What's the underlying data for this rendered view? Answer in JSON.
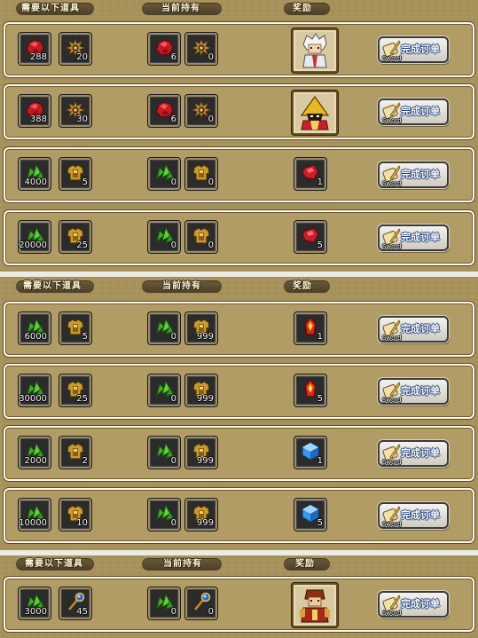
{
  "headers": {
    "required": "需要以下道具",
    "current": "当前持有",
    "reward": "奖励"
  },
  "button": {
    "label": "完成订单",
    "sub": "Sword"
  },
  "sections": [
    {
      "rows": [
        {
          "req": [
            {
              "icon": "red-ore-icon",
              "qty": "288"
            },
            {
              "icon": "bronze-emblem-icon",
              "qty": "20"
            }
          ],
          "have": [
            {
              "icon": "red-ore-icon",
              "qty": "6"
            },
            {
              "icon": "bronze-emblem-icon",
              "qty": "0"
            }
          ],
          "reward": {
            "type": "portrait",
            "icon": "white-haired-hero-portrait"
          }
        },
        {
          "req": [
            {
              "icon": "red-ore-icon",
              "qty": "388"
            },
            {
              "icon": "bronze-emblem-icon",
              "qty": "30"
            }
          ],
          "have": [
            {
              "icon": "red-ore-icon",
              "qty": "6"
            },
            {
              "icon": "bronze-emblem-icon",
              "qty": "0"
            }
          ],
          "reward": {
            "type": "portrait",
            "icon": "golden-helm-hero-portrait"
          }
        },
        {
          "req": [
            {
              "icon": "green-leaf-icon",
              "qty": "4000"
            },
            {
              "icon": "gold-armor-icon",
              "qty": "5"
            }
          ],
          "have": [
            {
              "icon": "green-leaf-icon",
              "qty": "0"
            },
            {
              "icon": "gold-armor-icon",
              "qty": "0"
            }
          ],
          "reward": {
            "type": "item",
            "icon": "red-gem-icon",
            "qty": "1"
          }
        },
        {
          "req": [
            {
              "icon": "green-leaf-icon",
              "qty": "20000"
            },
            {
              "icon": "gold-armor-icon",
              "qty": "25"
            }
          ],
          "have": [
            {
              "icon": "green-leaf-icon",
              "qty": "0"
            },
            {
              "icon": "gold-armor-icon",
              "qty": "0"
            }
          ],
          "reward": {
            "type": "item",
            "icon": "red-gem-icon",
            "qty": "5"
          }
        }
      ]
    },
    {
      "rows": [
        {
          "req": [
            {
              "icon": "green-leaf-icon",
              "qty": "6000"
            },
            {
              "icon": "gold-armor-icon",
              "qty": "5"
            }
          ],
          "have": [
            {
              "icon": "green-leaf-icon",
              "qty": "0"
            },
            {
              "icon": "gold-armor-icon",
              "qty": "999"
            }
          ],
          "reward": {
            "type": "item",
            "icon": "fire-crystal-icon",
            "qty": "1"
          }
        },
        {
          "req": [
            {
              "icon": "green-leaf-icon",
              "qty": "30000"
            },
            {
              "icon": "gold-armor-icon",
              "qty": "25"
            }
          ],
          "have": [
            {
              "icon": "green-leaf-icon",
              "qty": "0"
            },
            {
              "icon": "gold-armor-icon",
              "qty": "999"
            }
          ],
          "reward": {
            "type": "item",
            "icon": "fire-crystal-icon",
            "qty": "5"
          }
        },
        {
          "req": [
            {
              "icon": "green-leaf-icon",
              "qty": "2000"
            },
            {
              "icon": "gold-armor-icon",
              "qty": "2"
            }
          ],
          "have": [
            {
              "icon": "green-leaf-icon",
              "qty": "0"
            },
            {
              "icon": "gold-armor-icon",
              "qty": "999"
            }
          ],
          "reward": {
            "type": "item",
            "icon": "blue-cube-icon",
            "qty": "1"
          }
        },
        {
          "req": [
            {
              "icon": "green-leaf-icon",
              "qty": "10000"
            },
            {
              "icon": "gold-armor-icon",
              "qty": "10"
            }
          ],
          "have": [
            {
              "icon": "green-leaf-icon",
              "qty": "0"
            },
            {
              "icon": "gold-armor-icon",
              "qty": "999"
            }
          ],
          "reward": {
            "type": "item",
            "icon": "blue-cube-icon",
            "qty": "5"
          }
        }
      ]
    },
    {
      "rows": [
        {
          "req": [
            {
              "icon": "green-leaf-icon",
              "qty": "3000"
            },
            {
              "icon": "magic-staff-icon",
              "qty": "45"
            }
          ],
          "have": [
            {
              "icon": "green-leaf-icon",
              "qty": "0"
            },
            {
              "icon": "magic-staff-icon",
              "qty": "0"
            }
          ],
          "reward": {
            "type": "portrait",
            "icon": "red-armored-hero-portrait"
          }
        }
      ]
    }
  ]
}
